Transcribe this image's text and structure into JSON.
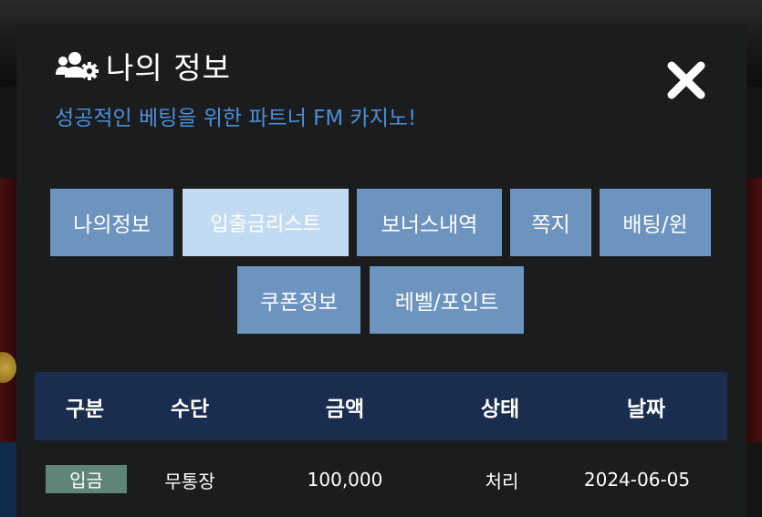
{
  "modal": {
    "title": "나의 정보",
    "subtitle": "성공적인 베팅을 위한 파트너 FM 카지노!",
    "title_icon": "users-gear-icon",
    "close_icon": "close-icon"
  },
  "tabs": [
    {
      "label": "나의정보",
      "active": false
    },
    {
      "label": "입출금리스트",
      "active": true
    },
    {
      "label": "보너스내역",
      "active": false
    },
    {
      "label": "쪽지",
      "active": false
    },
    {
      "label": "배팅/윈",
      "active": false
    },
    {
      "label": "쿠폰정보",
      "active": false
    },
    {
      "label": "레벨/포인트",
      "active": false
    }
  ],
  "table": {
    "headers": [
      "구분",
      "수단",
      "금액",
      "상태",
      "날짜"
    ],
    "rows": [
      {
        "type": "입금",
        "method": "무통장",
        "amount": "100,000",
        "status": "처리",
        "date": "2024-06-05"
      }
    ]
  },
  "colors": {
    "tab": "#6d93bf",
    "tab_active": "#c3dbf2",
    "subtitle": "#4d8ed6",
    "table_header": "#1a2d4e",
    "deposit_badge": "#5f8479",
    "modal_bg": "#1a1c1e"
  }
}
